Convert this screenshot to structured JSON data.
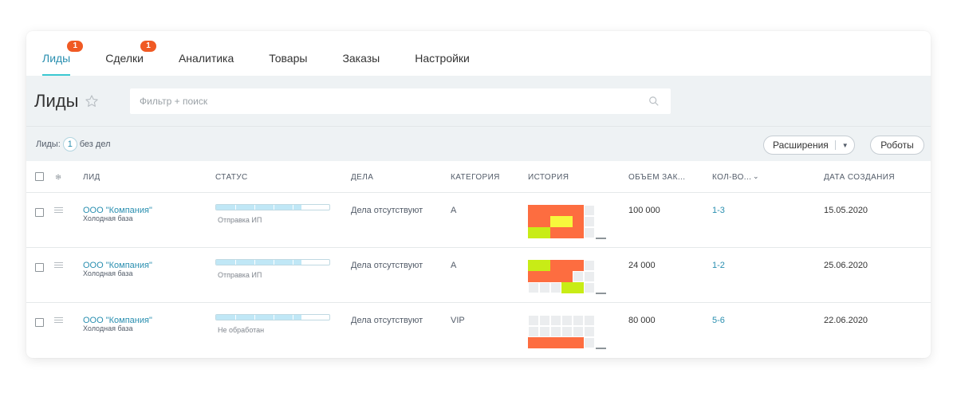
{
  "tabs": [
    {
      "label": "Лиды",
      "badge": "1",
      "active": true
    },
    {
      "label": "Сделки",
      "badge": "1",
      "active": false
    },
    {
      "label": "Аналитика",
      "badge": "",
      "active": false
    },
    {
      "label": "Товары",
      "badge": "",
      "active": false
    },
    {
      "label": "Заказы",
      "badge": "",
      "active": false
    },
    {
      "label": "Настройки",
      "badge": "",
      "active": false
    }
  ],
  "header": {
    "title": "Лиды",
    "search_placeholder": "Фильтр + поиск"
  },
  "counter": {
    "prefix": "Лиды:",
    "count": "1",
    "suffix": "без дел"
  },
  "buttons": {
    "extensions": "Расширения",
    "robots": "Роботы"
  },
  "columns": {
    "lead": "Лид",
    "status": "Статус",
    "tasks": "Дела",
    "category": "Категория",
    "history": "История",
    "volume": "Объем зак...",
    "qty": "Кол-во...",
    "created": "Дата создания"
  },
  "colors": {
    "accent": "#2a8fb0",
    "tab_underline": "#3bc8d1",
    "badge": "#f05a24",
    "history_orange": "#fd6d40",
    "history_yellow": "#f7f83c",
    "history_lime": "#c8ec16",
    "history_empty": "#ebedef",
    "status_fill": "#c0e7f6"
  },
  "rows": [
    {
      "name": "ООО \"Компания\"",
      "source": "Холодная база",
      "status_label": "Отправка ИП",
      "status_progress": 0.75,
      "tasks": "Дела отсутствуют",
      "category": "A",
      "volume": "100 000",
      "qty": "1-3",
      "created": "15.05.2020",
      "history": [
        [
          "orange",
          "orange",
          "orange",
          "orange",
          "orange",
          "empty"
        ],
        [
          "orange",
          "orange",
          "yellow",
          "yellow",
          "orange",
          "empty"
        ],
        [
          "lime",
          "lime",
          "orange",
          "orange",
          "orange",
          "empty"
        ]
      ]
    },
    {
      "name": "ООО \"Компания\"",
      "source": "Холодная база",
      "status_label": "Отправка ИП",
      "status_progress": 0.75,
      "tasks": "Дела отсутствуют",
      "category": "A",
      "volume": "24 000",
      "qty": "1-2",
      "created": "25.06.2020",
      "history": [
        [
          "lime",
          "lime",
          "orange",
          "orange",
          "orange",
          "empty"
        ],
        [
          "orange",
          "orange",
          "orange",
          "orange",
          "empty",
          "empty"
        ],
        [
          "empty",
          "empty",
          "empty",
          "lime",
          "lime",
          "empty"
        ]
      ]
    },
    {
      "name": "ООО \"Компания\"",
      "source": "Холодная база",
      "status_label": "Не обработан",
      "status_progress": 0.75,
      "tasks": "Дела отсутствуют",
      "category": "VIP",
      "volume": "80 000",
      "qty": "5-6",
      "created": "22.06.2020",
      "history": [
        [
          "empty",
          "empty",
          "empty",
          "empty",
          "empty",
          "empty"
        ],
        [
          "empty",
          "empty",
          "empty",
          "empty",
          "empty",
          "empty"
        ],
        [
          "orange",
          "orange",
          "orange",
          "orange",
          "orange",
          "empty"
        ]
      ]
    }
  ]
}
